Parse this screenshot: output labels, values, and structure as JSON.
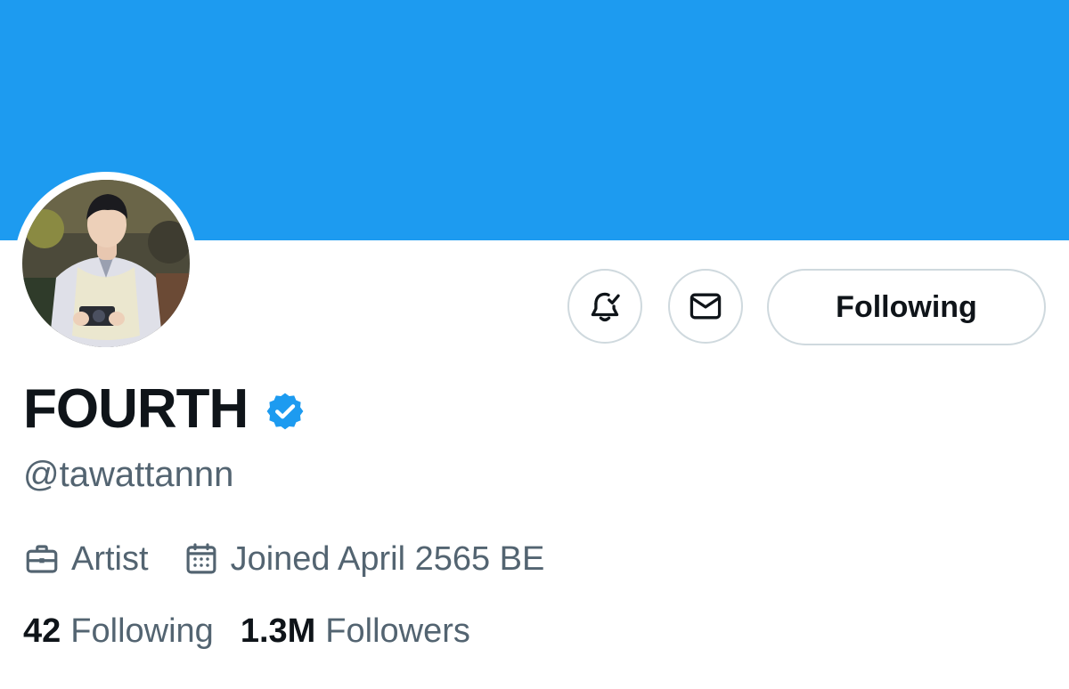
{
  "profile": {
    "display_name": "FOURTH",
    "handle": "@tawattannn",
    "verified": true,
    "category": "Artist",
    "joined": "Joined April 2565 BE"
  },
  "actions": {
    "following_label": "Following"
  },
  "stats": {
    "following_count": "42",
    "following_label": "Following",
    "followers_count": "1.3M",
    "followers_label": "Followers"
  },
  "icons": {
    "notify": "bell-check-icon",
    "message": "mail-icon",
    "verified": "verified-badge-icon",
    "category": "briefcase-icon",
    "joined": "calendar-icon"
  },
  "colors": {
    "banner": "#1d9bf0",
    "text_primary": "#0f1419",
    "text_secondary": "#536471",
    "border": "#cfd9de",
    "verified": "#1d9bf0"
  }
}
